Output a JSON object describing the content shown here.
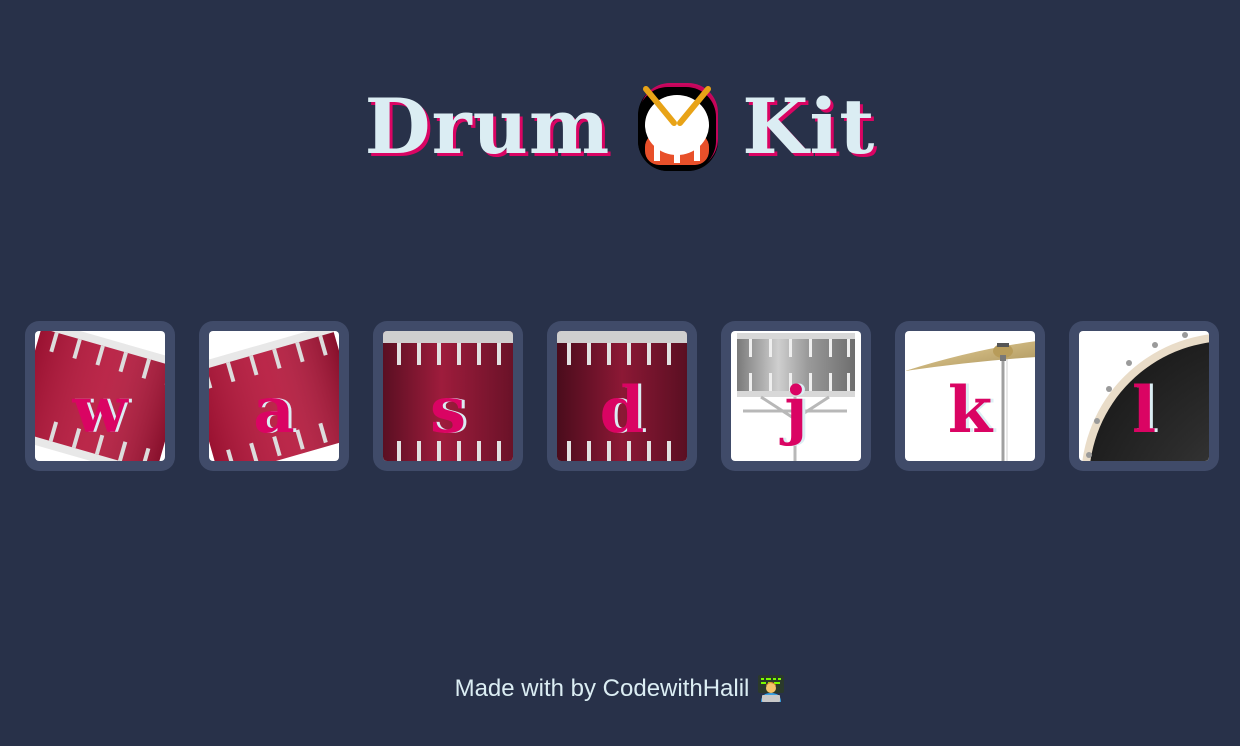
{
  "header": {
    "title_left": "Drum",
    "title_right": "Kit",
    "title_icon": "drum-emoji"
  },
  "colors": {
    "background": "#283149",
    "tile": "#404B69",
    "text": "#DBEDF3",
    "accent": "#DA0463"
  },
  "drums": [
    {
      "key": "w",
      "instrument": "tom-1"
    },
    {
      "key": "a",
      "instrument": "tom-2"
    },
    {
      "key": "s",
      "instrument": "tom-3"
    },
    {
      "key": "d",
      "instrument": "tom-4"
    },
    {
      "key": "j",
      "instrument": "snare"
    },
    {
      "key": "k",
      "instrument": "crash"
    },
    {
      "key": "l",
      "instrument": "kick-bass"
    }
  ],
  "footer": {
    "text": "Made with  by CodewithHalil",
    "icon": "technologist-emoji"
  }
}
